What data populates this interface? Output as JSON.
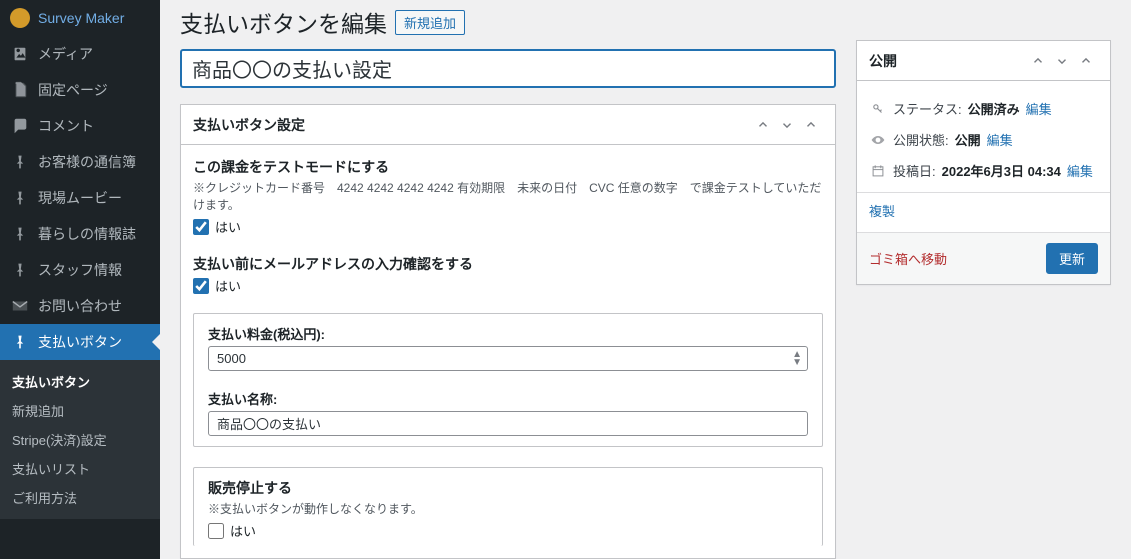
{
  "sidebar": {
    "items": [
      {
        "label": "Survey Maker"
      },
      {
        "label": "メディア"
      },
      {
        "label": "固定ページ"
      },
      {
        "label": "コメント"
      },
      {
        "label": "お客様の通信簿"
      },
      {
        "label": "現場ムービー"
      },
      {
        "label": "暮らしの情報誌"
      },
      {
        "label": "スタッフ情報"
      },
      {
        "label": "お問い合わせ"
      },
      {
        "label": "支払いボタン"
      }
    ],
    "submenu": [
      "支払いボタン",
      "新規追加",
      "Stripe(決済)設定",
      "支払いリスト",
      "ご利用方法"
    ]
  },
  "heading": "支払いボタンを編集",
  "add_new": "新規追加",
  "title_value": "商品〇〇の支払い設定",
  "settings": {
    "box_title": "支払いボタン設定",
    "test_mode_title": "この課金をテストモードにする",
    "test_mode_note": "※クレジットカード番号　4242 4242 4242 4242 有効期限　未来の日付　CVC 任意の数字　で課金テストしていただけます。",
    "yes": "はい",
    "email_confirm_title": "支払い前にメールアドレスの入力確認をする",
    "price_label": "支払い料金(税込円):",
    "price_value": "5000",
    "name_label": "支払い名称:",
    "name_value": "商品〇〇の支払い",
    "stop_title": "販売停止する",
    "stop_note": "※支払いボタンが動作しなくなります。"
  },
  "publish": {
    "box_title": "公開",
    "status_label": "ステータス:",
    "status_value": "公開済み",
    "edit": "編集",
    "visibility_label": "公開状態:",
    "visibility_value": "公開",
    "date_label": "投稿日:",
    "date_value": "2022年6月3日 04:34",
    "duplicate": "複製",
    "trash": "ゴミ箱へ移動",
    "update": "更新"
  }
}
